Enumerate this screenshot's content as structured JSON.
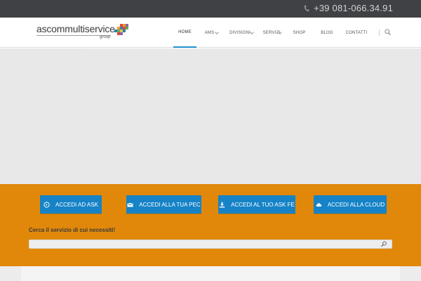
{
  "topbar": {
    "phone": "+39 081-066.34.91",
    "phone_icon": "phone-icon"
  },
  "logo": {
    "name": "ascommultiservice",
    "sub": "group"
  },
  "nav": {
    "items": [
      {
        "label": "HOME",
        "active": true
      },
      {
        "label": "AMS",
        "has_dropdown": true
      },
      {
        "label": "DIVISIONI",
        "has_dropdown": true
      },
      {
        "label": "SERVIZI",
        "has_dropdown": true
      },
      {
        "label": "SHOP"
      },
      {
        "label": "BLOG"
      },
      {
        "label": "CONTATTI"
      }
    ],
    "search_icon": "search-icon"
  },
  "actions": {
    "buttons": [
      {
        "label": "ACCEDI AD ASK",
        "icon": "circle-arrow-icon"
      },
      {
        "label": "ACCEDI ALLA TUA PEC",
        "icon": "envelope-icon"
      },
      {
        "label": "ACCEDI AL TUO ASK FE",
        "icon": "download-icon"
      },
      {
        "label": "ACCEDI ALLA CLOUD",
        "icon": "cloud-icon"
      }
    ]
  },
  "search": {
    "label": "Cerca il servizio di cui necessiti!",
    "value": "",
    "placeholder": ""
  },
  "colors": {
    "topbar": "#3f4144",
    "accent_blue": "#1683c7",
    "band_orange": "#e1880b",
    "hero_gray": "#e8e8e8"
  }
}
